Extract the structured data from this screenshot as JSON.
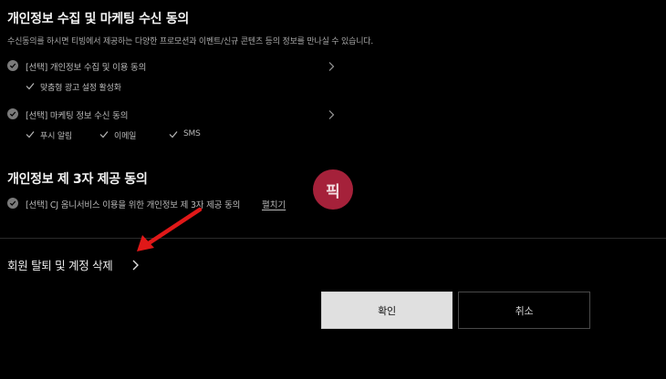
{
  "marketing": {
    "title": "개인정보 수집 및 마케팅 수신 동의",
    "description": "수신동의를 하시면 티빙에서 제공하는 다양한 프로모션과 이벤트/신규 콘텐츠 등의 정보를 만나실 수 있습니다.",
    "items": [
      {
        "label": "[선택] 개인정보 수집 및 이용 동의",
        "sub": [
          "맞춤형 광고 설정 활성화"
        ]
      },
      {
        "label": "[선택] 마케팅 정보 수신 동의",
        "sub": [
          "푸시 알림",
          "이메일",
          "SMS"
        ]
      }
    ]
  },
  "third_party": {
    "title": "개인정보 제 3자 제공 동의",
    "item_label": "[선택] CJ 옴니서비스 이용을 위한 개인정보 제 3자 제공 동의",
    "link": "펼치기"
  },
  "withdraw": {
    "label": "회원 탈퇴 및 계정 삭제"
  },
  "buttons": {
    "confirm": "확인",
    "cancel": "취소"
  },
  "watermark": {
    "text": "픽",
    "color": "#a5213a"
  },
  "annotation": {
    "arrow_color": "#e01818"
  },
  "colors": {
    "background": "#000000",
    "check_fill": "#7a7a7a",
    "confirm_bg": "#e0e0e0"
  }
}
